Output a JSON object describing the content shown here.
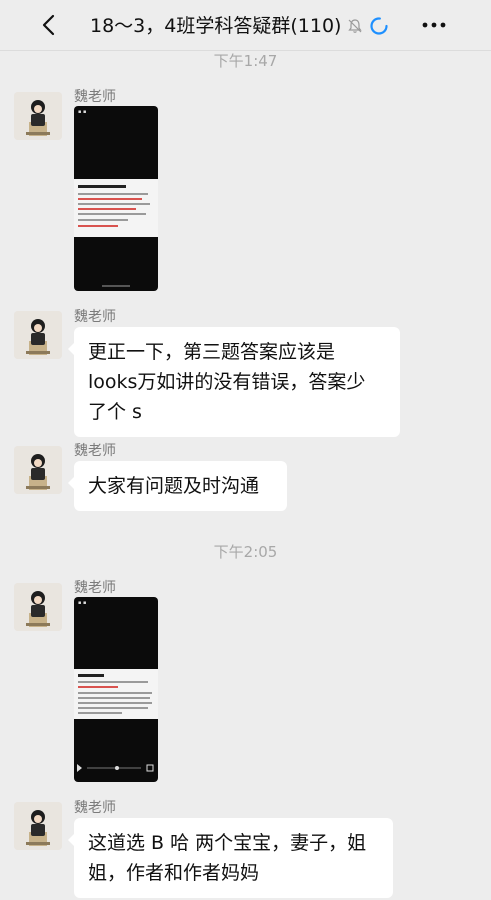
{
  "header": {
    "title": "18～3，4班学科答疑群(110)",
    "back_icon": "back-chevron-icon",
    "mute_icon": "bell-muted-icon",
    "loading_icon": "loading-spinner-icon",
    "more_icon": "more-dots-icon"
  },
  "timestamps": [
    "下午1:47",
    "下午2:05"
  ],
  "messages": [
    {
      "sender": "魏老师",
      "type": "image"
    },
    {
      "sender": "魏老师",
      "type": "text",
      "lines": [
        "更正一下，第三题答案应该是",
        "looks万如讲的没有错误，答案少",
        "了个 s"
      ]
    },
    {
      "sender": "魏老师",
      "type": "text",
      "lines": [
        "大家有问题及时沟通"
      ]
    },
    {
      "sender": "魏老师",
      "type": "video"
    },
    {
      "sender": "魏老师",
      "type": "text",
      "lines": [
        "这道选 B 哈 两个宝宝，妻子，姐",
        "姐，作者和作者妈妈"
      ]
    }
  ],
  "colors": {
    "background": "#ededed",
    "bubble": "#ffffff",
    "spinner": "#1e90ff"
  }
}
